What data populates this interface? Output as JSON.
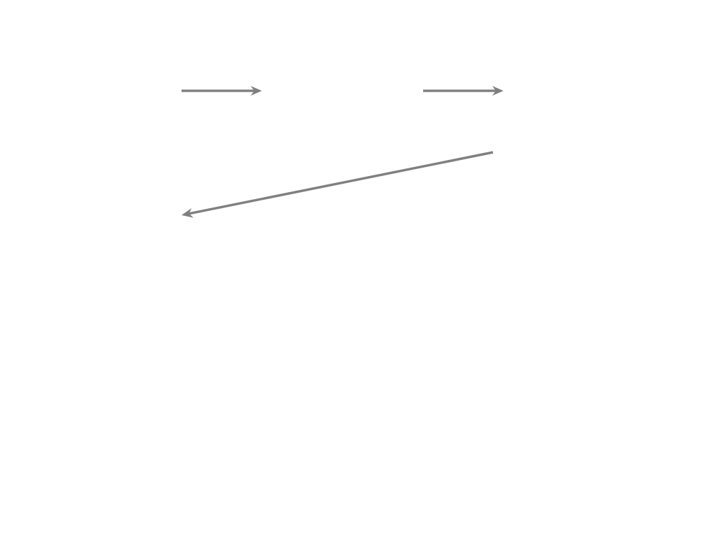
{
  "diagram": {
    "background": "#ffffff",
    "arrow_color": "#808080",
    "arrows": [
      {
        "name": "arrow-top-left",
        "direction": "right"
      },
      {
        "name": "arrow-top-right",
        "direction": "right"
      },
      {
        "name": "arrow-diagonal-return",
        "direction": "down-left"
      }
    ]
  }
}
